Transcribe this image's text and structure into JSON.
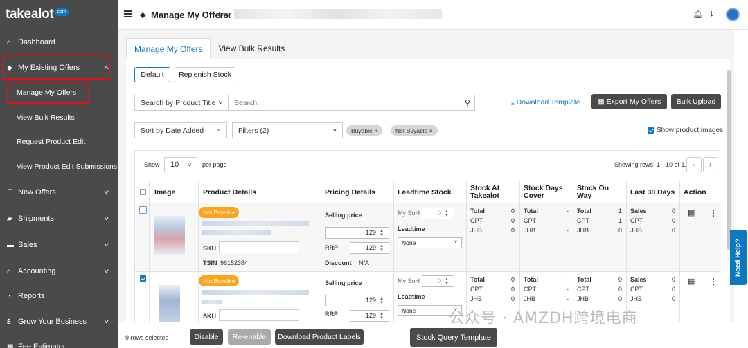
{
  "brand": {
    "logo_text": "takealot",
    "logo_badge": "com"
  },
  "sidebar": {
    "items": [
      {
        "label": "Dashboard",
        "icon": "home-icon"
      },
      {
        "label": "My Existing Offers",
        "icon": "tag-icon"
      },
      {
        "label": "Manage My Offers"
      },
      {
        "label": "View Bulk Results"
      },
      {
        "label": "Request Product Edit"
      },
      {
        "label": "View Product Edit Submissions"
      },
      {
        "label": "New Offers",
        "icon": "list-icon"
      },
      {
        "label": "Shipments",
        "icon": "truck-icon"
      },
      {
        "label": "Sales",
        "icon": "sales-icon"
      },
      {
        "label": "Accounting",
        "icon": "bank-icon"
      },
      {
        "label": "Reports",
        "icon": "reports-icon"
      },
      {
        "label": "Grow Your Business",
        "icon": "dollar-icon"
      },
      {
        "label": "Fee Estimator",
        "icon": "calculator-icon"
      }
    ],
    "highlight_color": "#e0101a"
  },
  "header": {
    "title": "Manage My Offers",
    "for_label": "For"
  },
  "tabs": [
    "Manage My Offers",
    "View Bulk Results"
  ],
  "views": {
    "default": "Default",
    "replenish": "Replenish Stock"
  },
  "search": {
    "type": "Search by Product Title",
    "placeholder": "Search..."
  },
  "actions": {
    "download_template": "Download Template",
    "export": "Export My Offers",
    "bulk_upload": "Bulk Upload"
  },
  "filters": {
    "sort": "Sort by Date Added",
    "filters": "Filters (2)",
    "chips": [
      "Buyable",
      "Not Buyable"
    ],
    "show_images": "Show product images"
  },
  "paging": {
    "show": "Show",
    "per_page_value": "10",
    "per_page": "per page",
    "showing": "Showing rows: 1 - 10 of 11"
  },
  "table": {
    "columns": [
      "Image",
      "Product Details",
      "Pricing Details",
      "Leadtime Stock",
      "Stock At Takealot",
      "Stock Days Cover",
      "Stock On Way",
      "Last 30 Days",
      "Action"
    ],
    "rows": [
      {
        "status": "Not Buyable",
        "sku_label": "SKU",
        "tsin_label": "TSIN",
        "tsin": "96152384",
        "selling_price_label": "Selling price",
        "selling_price": "129",
        "rrp_label": "RRP",
        "rrp": "129",
        "discount_label": "Discount",
        "discount": "N/A",
        "my_soh_label": "My SoH",
        "my_soh": "0",
        "leadtime_label": "Leadtime",
        "leadtime": "None",
        "stock_takealot": {
          "Total": "0",
          "CPT": "0",
          "JHB": "0"
        },
        "days_cover": {
          "Total": "-",
          "CPT": "-",
          "JHB": "-"
        },
        "on_way": {
          "Total": "1",
          "CPT": "1",
          "JHB": "0"
        },
        "last30": {
          "Sales": "0",
          "CPT": "0",
          "JHB": "0"
        }
      },
      {
        "status": "Not Buyable",
        "sku_label": "SKU",
        "selling_price_label": "Selling price",
        "selling_price": "129",
        "rrp_label": "RRP",
        "rrp": "129",
        "my_soh_label": "My SoH",
        "my_soh": "0",
        "leadtime_label": "Leadtime",
        "leadtime": "None",
        "stock_takealot": {
          "Total": "0",
          "CPT": "0",
          "JHB": "0"
        },
        "days_cover": {
          "Total": "-",
          "CPT": "-",
          "JHB": "-"
        },
        "on_way": {
          "Total": "0",
          "CPT": "0",
          "JHB": "0"
        },
        "last30": {
          "Sales": "0",
          "CPT": "0",
          "JHB": "0"
        }
      }
    ]
  },
  "footer": {
    "selected": "9 rows selected",
    "disable": "Disable",
    "reenable": "Re-enable",
    "labels": "Download Product Labels",
    "stock_query": "Stock Query Template"
  },
  "help": "Need Help?",
  "watermark": "公众号 · AMZDH跨境电商"
}
